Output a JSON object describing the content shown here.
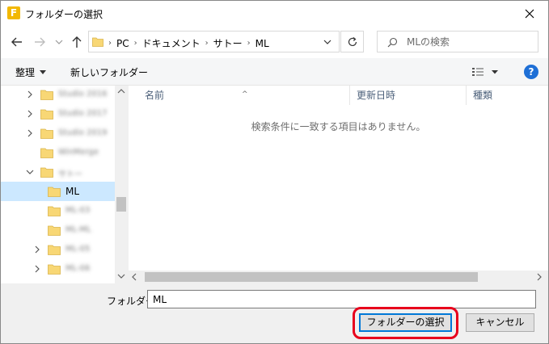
{
  "window": {
    "title": "フォルダーの選択",
    "app_icon_letter": "F"
  },
  "navigation": {
    "breadcrumbs": [
      "PC",
      "ドキュメント",
      "サトー",
      "ML"
    ],
    "search_placeholder": "MLの検索"
  },
  "toolbar": {
    "organize_label": "整理",
    "new_folder_label": "新しいフォルダー"
  },
  "tree": {
    "items": [
      {
        "label": "Studio 2016",
        "blurred": true,
        "expander": "right",
        "selected": false
      },
      {
        "label": "Studio 2017",
        "blurred": true,
        "expander": "right",
        "selected": false
      },
      {
        "label": "Studio 2019",
        "blurred": true,
        "expander": "right",
        "selected": false
      },
      {
        "label": "WinMerge",
        "blurred": true,
        "expander": "none",
        "selected": false
      },
      {
        "label": "サトー",
        "blurred": true,
        "expander": "down",
        "selected": false
      },
      {
        "label": "ML",
        "blurred": false,
        "expander": "none",
        "selected": true
      },
      {
        "label": "ML-03",
        "blurred": true,
        "expander": "none",
        "selected": false
      },
      {
        "label": "ML-ML",
        "blurred": true,
        "expander": "none",
        "selected": false
      },
      {
        "label": "ML-05",
        "blurred": true,
        "expander": "right",
        "selected": false
      },
      {
        "label": "ML-06",
        "blurred": true,
        "expander": "right",
        "selected": false
      }
    ]
  },
  "list": {
    "columns": {
      "name": "名前",
      "date": "更新日時",
      "type": "種類"
    },
    "empty_message": "検索条件に一致する項目はありません。"
  },
  "bottom": {
    "folder_label": "フォルダー:",
    "folder_value": "ML",
    "select_button": "フォルダーの選択",
    "cancel_button": "キャンセル"
  },
  "colors": {
    "selection": "#cce8ff",
    "highlight_ring": "#e8001c",
    "folder": "#f8d775",
    "help": "#1e6fd6"
  }
}
